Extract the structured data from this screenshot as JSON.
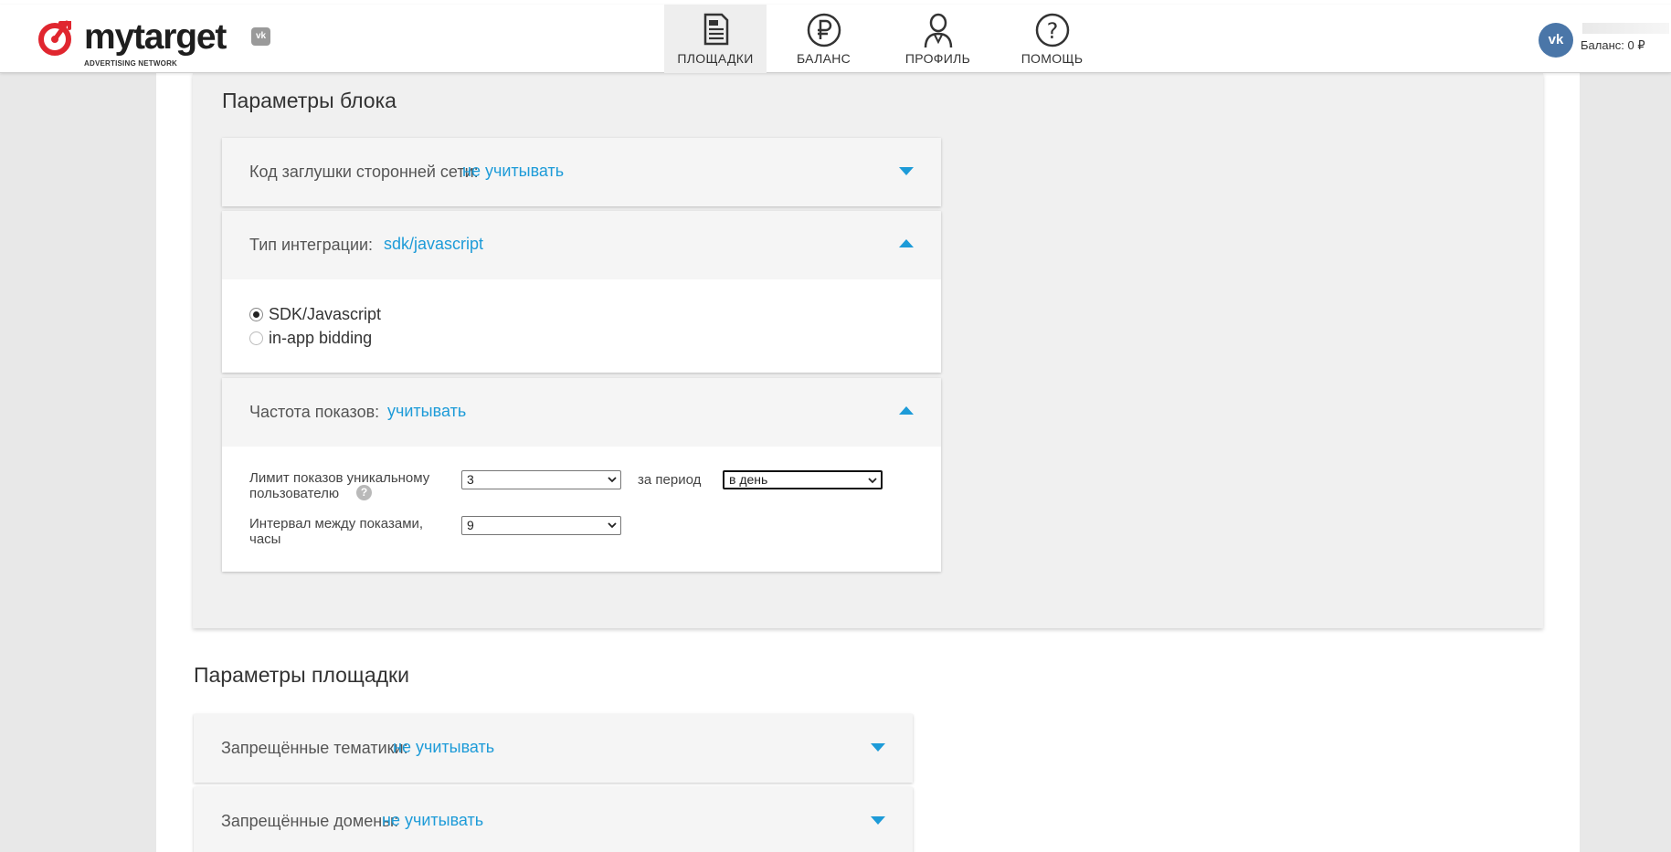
{
  "header": {
    "logo_text": "mytarget",
    "logo_subtitle": "ADVERTISING NETWORK",
    "vk_badge": "vk",
    "nav": [
      {
        "label": "ПЛОЩАДКИ",
        "icon": "document-icon",
        "active": true
      },
      {
        "label": "БАЛАНС",
        "icon": "ruble-icon",
        "active": false
      },
      {
        "label": "ПРОФИЛЬ",
        "icon": "user-icon",
        "active": false
      },
      {
        "label": "ПОМОЩЬ",
        "icon": "question-icon",
        "active": false
      }
    ],
    "user": {
      "avatar_text": "vk",
      "balance": "Баланс: 0 ₽"
    }
  },
  "block_params": {
    "title": "Параметры блока",
    "stub_code": {
      "label": "Код заглушки сторонней сети:",
      "value": "не учитывать",
      "expanded": false
    },
    "integration": {
      "label": "Тип интеграции:",
      "value": "sdk/javascript",
      "expanded": true,
      "options": [
        {
          "label": "SDK/Javascript",
          "selected": true
        },
        {
          "label": "in-app bidding",
          "selected": false
        }
      ]
    },
    "frequency": {
      "label": "Частота показов:",
      "value": "учитывать",
      "expanded": true,
      "limit_label_line1": "Лимит показов уникальному",
      "limit_label_line2": "пользователю",
      "help_icon": "?",
      "limit_value": "3",
      "period_label": "за период",
      "period_value": "в день",
      "interval_label_line1": "Интервал между показами,",
      "interval_label_line2": "часы",
      "interval_value": "9"
    }
  },
  "site_params": {
    "title": "Параметры площадки",
    "forbidden_topics": {
      "label": "Запрещённые тематики:",
      "value": "не учитывать",
      "expanded": false
    },
    "forbidden_domains": {
      "label": "Запрещённые домены:",
      "value": "не учитывать",
      "expanded": false
    }
  },
  "colors": {
    "accent": "#1d9bd8",
    "brand_red": "#e0262f",
    "vk_blue": "#4a76a8"
  }
}
